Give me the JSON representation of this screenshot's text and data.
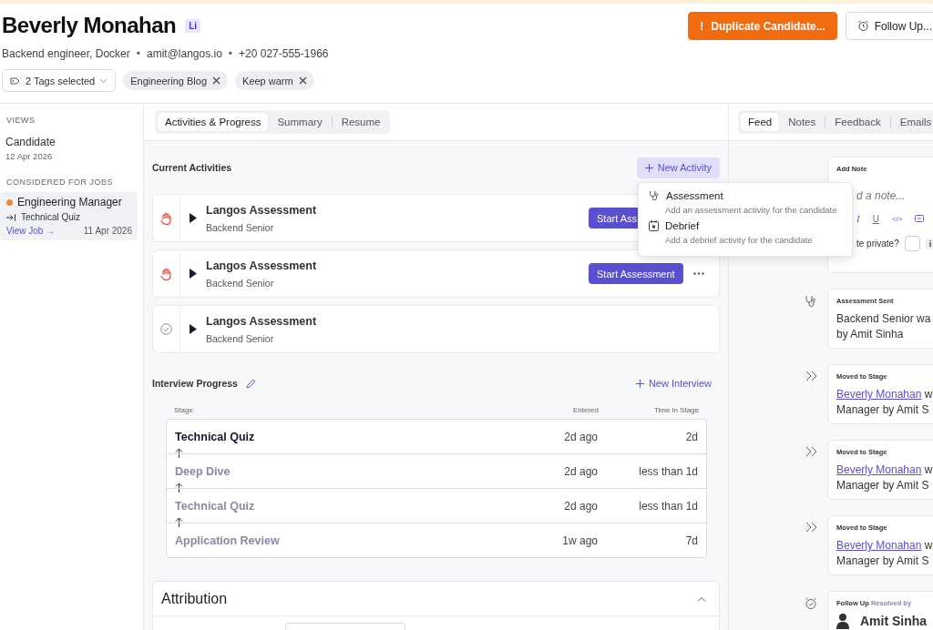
{
  "header": {
    "name": "Beverly Monahan",
    "badge": "Li",
    "headline": "Backend engineer, Docker",
    "separator": "•",
    "email": "amit@langos.io",
    "phone": "+20 027-555-1966",
    "tags_select": {
      "label": "2 Tags selected"
    },
    "tags": [
      {
        "label": "Engineering Blog"
      },
      {
        "label": "Keep warm"
      }
    ],
    "buttons": [
      {
        "kind": "warning",
        "icon": "!",
        "label": "Duplicate Candidate..."
      },
      {
        "kind": "default",
        "label": "Follow Up..."
      }
    ]
  },
  "sidebar": {
    "views_heading": "VIEWS",
    "view": {
      "title": "Candidate",
      "date": "12 Apr 2026"
    },
    "jobs_heading": "CONSIDERED FOR JOBS",
    "jobs": [
      {
        "title": "Engineering Manager",
        "color": "#f4863a",
        "selected": true,
        "stage": "Technical Quiz",
        "link": "View Job →",
        "date": "11 Apr 2026"
      }
    ]
  },
  "main": {
    "tabs": [
      {
        "label": "Activities & Progress",
        "selected": true
      },
      {
        "label": "Summary",
        "selected": false
      },
      {
        "label": "Resume",
        "selected": false
      }
    ],
    "current_activities": {
      "title": "Current Activities",
      "new_button": "New Activity",
      "items": [
        {
          "kind": "blocked",
          "title": "Langos Assessment",
          "subtitle": "Backend Senior",
          "action": "Start Ass",
          "more": false
        },
        {
          "kind": "blocked",
          "title": "Langos Assessment",
          "subtitle": "Backend Senior",
          "action": "Start Assessment",
          "more": true
        },
        {
          "kind": "done",
          "title": "Langos Assessment",
          "subtitle": "Backend Senior",
          "more": false
        }
      ]
    },
    "menu": {
      "items": [
        {
          "kind": "assessment",
          "label": "Assessment",
          "description": "Add an assessment activity for the candidate"
        },
        {
          "kind": "debrief",
          "label": "Debrief",
          "description": "Add a debrief activity for the candidate"
        }
      ]
    },
    "interview_progress": {
      "title": "Interview Progress",
      "new_button": "New Interview",
      "columns": [
        "Stage",
        "Entered",
        "Time in Stage"
      ],
      "rows": [
        {
          "stage": "Technical Quiz",
          "entered": "2d ago",
          "time": "2d",
          "current": true
        },
        {
          "stage": "Deep Dive",
          "entered": "2d ago",
          "time": "less than 1d",
          "current": false
        },
        {
          "stage": "Technical Quiz",
          "entered": "2d ago",
          "time": "less than 1d",
          "current": false
        },
        {
          "stage": "Application Review",
          "entered": "1w ago",
          "time": "7d",
          "current": false
        }
      ]
    },
    "attribution": {
      "title": "Attribution",
      "expanded": true
    }
  },
  "feed": {
    "tabs": [
      {
        "label": "Feed",
        "selected": true
      },
      {
        "label": "Notes",
        "selected": false
      },
      {
        "label": "Feedback",
        "selected": false
      },
      {
        "label": "Emails",
        "selected": false
      }
    ],
    "note": {
      "title": "Add Note",
      "placeholder": "d a note...",
      "format_buttons": [
        {
          "kind": "italic",
          "label": "I"
        },
        {
          "kind": "underline",
          "label": "U"
        },
        {
          "kind": "code",
          "label": "</>"
        }
      ],
      "private_label": "te private?",
      "private": false,
      "info": "i"
    },
    "items": [
      {
        "kind": "assessment",
        "title": "Assessment Sent",
        "line1": "Backend Senior wa",
        "line2": "by Amit Sinha"
      },
      {
        "kind": "moved",
        "title": "Moved to Stage",
        "link": "Beverly Monahan",
        "line1": "w",
        "line2": "Manager by Amit S"
      },
      {
        "kind": "moved",
        "title": "Moved to Stage",
        "link": "Beverly Monahan",
        "line1": "w",
        "line2": "Manager by Amit S"
      },
      {
        "kind": "moved",
        "title": "Moved to Stage",
        "link": "Beverly Monahan",
        "line1": "w",
        "line2": "Manager by Amit S"
      },
      {
        "kind": "follow_up",
        "title": "Follow Up",
        "suffix": "Resolved by",
        "person": "Amit Sinha"
      }
    ]
  }
}
